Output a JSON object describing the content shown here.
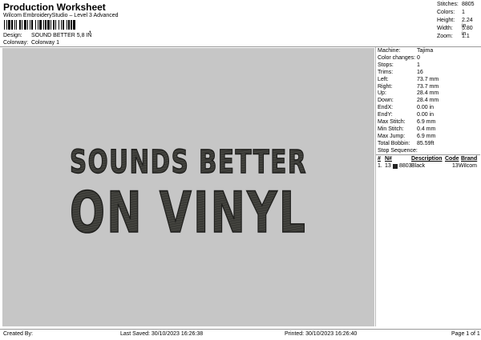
{
  "header": {
    "title": "Production Worksheet",
    "subtitle": "Wilcom EmbroideryStudio – Level 3 Advanced",
    "barcode_suffix": ",",
    "design_label": "Design:",
    "design_value": "SOUND BETTER 5,8 IN",
    "colorway_label": "Colorway:",
    "colorway_value": "Colorway 1"
  },
  "stats": [
    {
      "k": "Stitches:",
      "v": "8805"
    },
    {
      "k": "Colors:",
      "v": "1"
    },
    {
      "k": "Height:",
      "v": "2.24 in"
    },
    {
      "k": "Width:",
      "v": "5.80 in"
    },
    {
      "k": "Zoom:",
      "v": "1:1"
    }
  ],
  "design": {
    "line1": "SOUNDS BETTER",
    "line2": "ON VINYL",
    "thread_color": "#3a3a36"
  },
  "machine_info": [
    {
      "k": "Machine:",
      "v": "Tajima"
    },
    {
      "k": "Color changes:",
      "v": "0"
    },
    {
      "k": "Stops:",
      "v": "1"
    },
    {
      "k": "Trims:",
      "v": "16"
    },
    {
      "k": "Left:",
      "v": "73.7 mm"
    },
    {
      "k": "Right:",
      "v": "73.7 mm"
    },
    {
      "k": "Up:",
      "v": "28.4 mm"
    },
    {
      "k": "Down:",
      "v": "28.4 mm"
    },
    {
      "k": "EndX:",
      "v": "0.00 in"
    },
    {
      "k": "EndY:",
      "v": "0.00 in"
    },
    {
      "k": "Max Stitch:",
      "v": "6.9 mm"
    },
    {
      "k": "Min Stitch:",
      "v": "0.4 mm"
    },
    {
      "k": "Max Jump:",
      "v": "6.9 mm"
    },
    {
      "k": "Total Bobbin:",
      "v": "85.59ft"
    }
  ],
  "stop_sequence": {
    "label": "Stop Sequence:",
    "headers": {
      "num": "#",
      "n": "N#",
      "desc": "Description",
      "code": "Code",
      "brand": "Brand"
    },
    "rows": [
      {
        "num": "1.",
        "n": "13",
        "swatch": "8803",
        "desc": "Black",
        "code": "13",
        "brand": "Wilcom",
        "color": "#222222"
      }
    ]
  },
  "footer": {
    "created": "Created By:",
    "saved": "Last Saved: 30/10/2023 16:26:38",
    "printed": "Printed: 30/10/2023 16:26:40",
    "page": "Page 1 of 1"
  }
}
